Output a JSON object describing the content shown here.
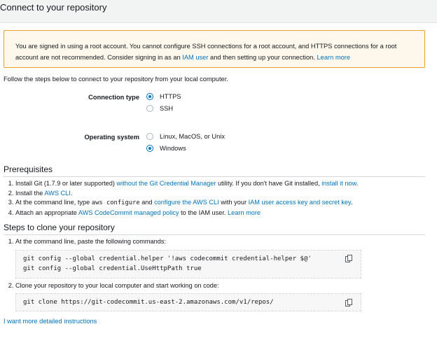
{
  "header": {
    "title": "Connect to your repository"
  },
  "alert": {
    "text_1": "You are signed in using a root account. You cannot configure SSH connections for a root account, and HTTPS connections for a root account are not recommended. Consider signing in as an ",
    "link_iam_user": "IAM user",
    "text_2": " and then setting up your connection. ",
    "link_learn_more": "Learn more"
  },
  "intro": "Follow the steps below to connect to your repository from your local computer.",
  "connection_type": {
    "label": "Connection type",
    "options": [
      {
        "label": "HTTPS",
        "selected": true
      },
      {
        "label": "SSH",
        "selected": false
      }
    ]
  },
  "operating_system": {
    "label": "Operating system",
    "options": [
      {
        "label": "Linux, MacOS, or Unix",
        "selected": false
      },
      {
        "label": "Windows",
        "selected": true
      }
    ]
  },
  "prerequisites": {
    "title": "Prerequisites",
    "item1": {
      "t1": "Install Git (1.7.9 or later supported) ",
      "link1": "without the Git Credential Manager",
      "t2": " utility. If you don't have Git installed, ",
      "link2": "install it now",
      "t3": "."
    },
    "item2": {
      "t1": "Install the ",
      "link1": "AWS CLI",
      "t2": "."
    },
    "item3": {
      "t1": "At the command line, type ",
      "code": "aws configure",
      "t2": " and ",
      "link1": "configure the AWS CLI",
      "t3": " with your ",
      "link2": "IAM user access key and secret key",
      "t4": "."
    },
    "item4": {
      "t1": "Attach an appropriate ",
      "link1": "AWS CodeCommit managed policy",
      "t2": " to the IAM user. ",
      "link2": "Learn more"
    }
  },
  "steps": {
    "title": "Steps to clone your repository",
    "step1": {
      "text": "At the command line, paste the following commands:",
      "code_line1": "git config --global credential.helper '!aws codecommit credential-helper $@'",
      "code_line2": "git config --global credential.UseHttpPath true"
    },
    "step2": {
      "text": "Clone your repository to your local computer and start working on code:",
      "code_line1": "git clone https://git-codecommit.us-east-2.amazonaws.com/v1/repos/"
    }
  },
  "more_link": "I want more detailed instructions",
  "icons": {
    "copy": "copy-icon"
  }
}
